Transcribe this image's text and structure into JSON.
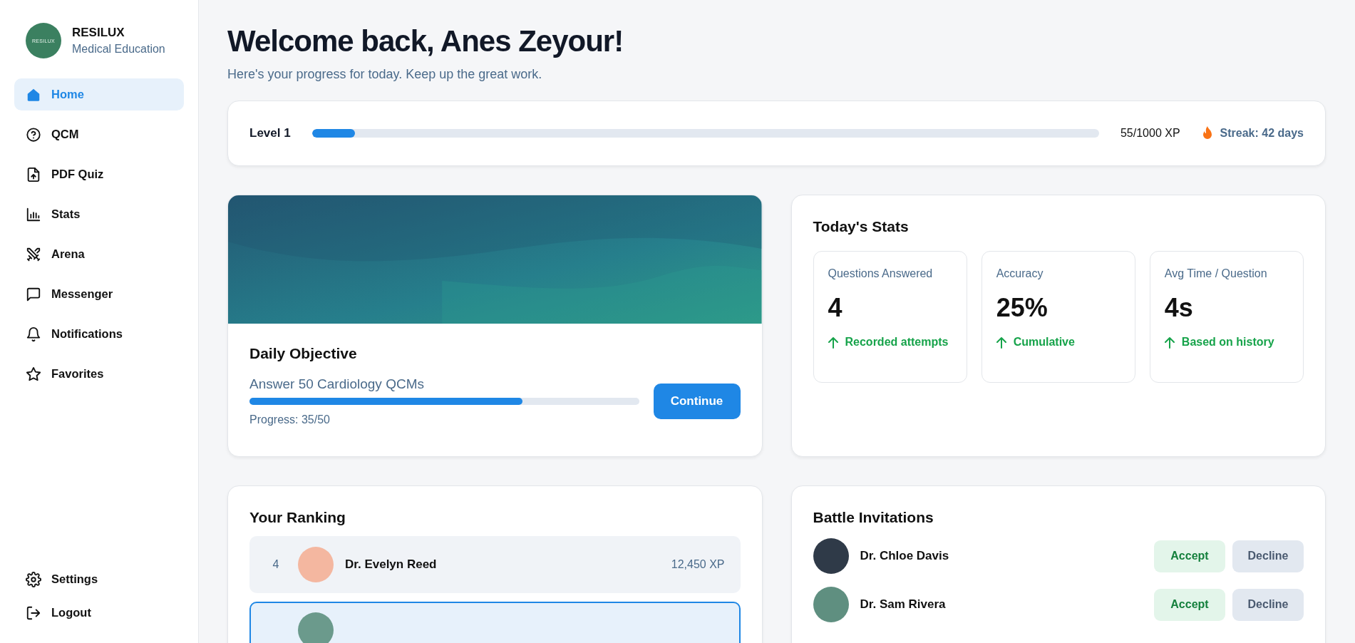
{
  "sidebar": {
    "brand": {
      "logo_text": "RESILUX",
      "name": "RESILUX",
      "subtitle": "Medical Education"
    },
    "nav": [
      {
        "label": "Home",
        "selected": true
      },
      {
        "label": "QCM",
        "selected": false
      },
      {
        "label": "PDF Quiz",
        "selected": false
      },
      {
        "label": "Stats",
        "selected": false
      },
      {
        "label": "Arena",
        "selected": false
      },
      {
        "label": "Messenger",
        "selected": false
      },
      {
        "label": "Notifications",
        "selected": false
      },
      {
        "label": "Favorites",
        "selected": false
      }
    ],
    "footer": [
      {
        "label": "Settings"
      },
      {
        "label": "Logout"
      }
    ]
  },
  "header": {
    "title": "Welcome back, Anes Zeyour!",
    "subtitle": "Here's your progress for today. Keep up the great work."
  },
  "level_bar": {
    "label": "Level 1",
    "level": 0.055,
    "xp": "55/1000 XP",
    "streak": "Streak: 42 days"
  },
  "daily_objective": {
    "title": "Daily Objective",
    "goal": "Answer 50 Cardiology QCMs",
    "level": 0.7,
    "progress": "Progress: 35/50",
    "button": "Continue"
  },
  "todays_stats": {
    "title": "Today's Stats",
    "cards": [
      {
        "label": "Questions Answered",
        "value": "4",
        "note": "Recorded attempts"
      },
      {
        "label": "Accuracy",
        "value": "25%",
        "note": "Cumulative"
      },
      {
        "label": "Avg Time / Question",
        "value": "4s",
        "note": "Based on history"
      }
    ]
  },
  "ranking": {
    "title": "Your Ranking",
    "rows": [
      {
        "rank": "4",
        "name": "Dr. Evelyn Reed",
        "xp": "12,450 XP",
        "selected": false
      },
      {
        "selected": true
      }
    ]
  },
  "battle_invitations": {
    "title": "Battle Invitations",
    "items": [
      {
        "name": "Dr. Chloe Davis",
        "accept": "Accept",
        "decline": "Decline"
      },
      {
        "name": "Dr. Sam Rivera",
        "accept": "Accept",
        "decline": "Decline"
      }
    ]
  }
}
